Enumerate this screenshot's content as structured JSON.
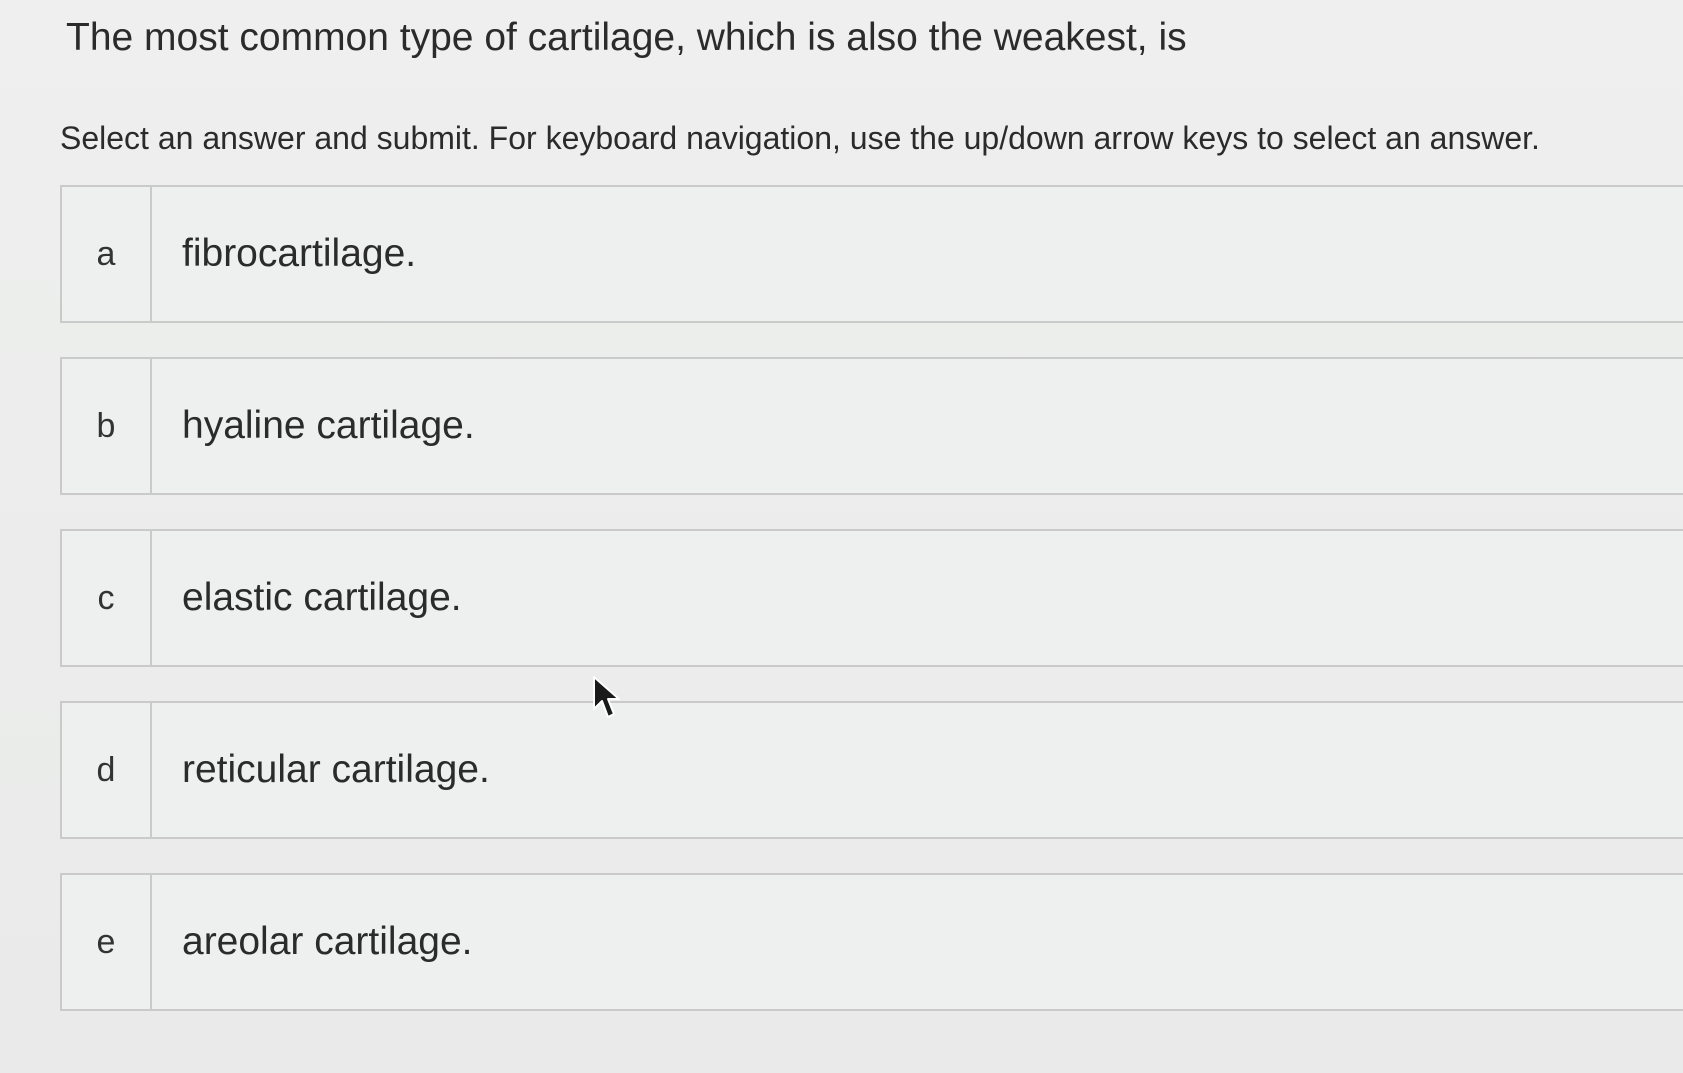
{
  "question": {
    "text": "The most common type of cartilage, which is also the weakest, is"
  },
  "instructions": {
    "text": "Select an answer and submit. For keyboard navigation, use the up/down arrow keys to select an answer."
  },
  "options": [
    {
      "letter": "a",
      "text": "fibrocartilage."
    },
    {
      "letter": "b",
      "text": "hyaline cartilage."
    },
    {
      "letter": "c",
      "text": "elastic cartilage."
    },
    {
      "letter": "d",
      "text": "reticular cartilage."
    },
    {
      "letter": "e",
      "text": "areolar cartilage."
    }
  ],
  "cursor": {
    "icon": "mouse-pointer-icon"
  },
  "colors": {
    "background": "#eceded",
    "option_border": "#c9cac9",
    "text": "#2b2b2b"
  }
}
